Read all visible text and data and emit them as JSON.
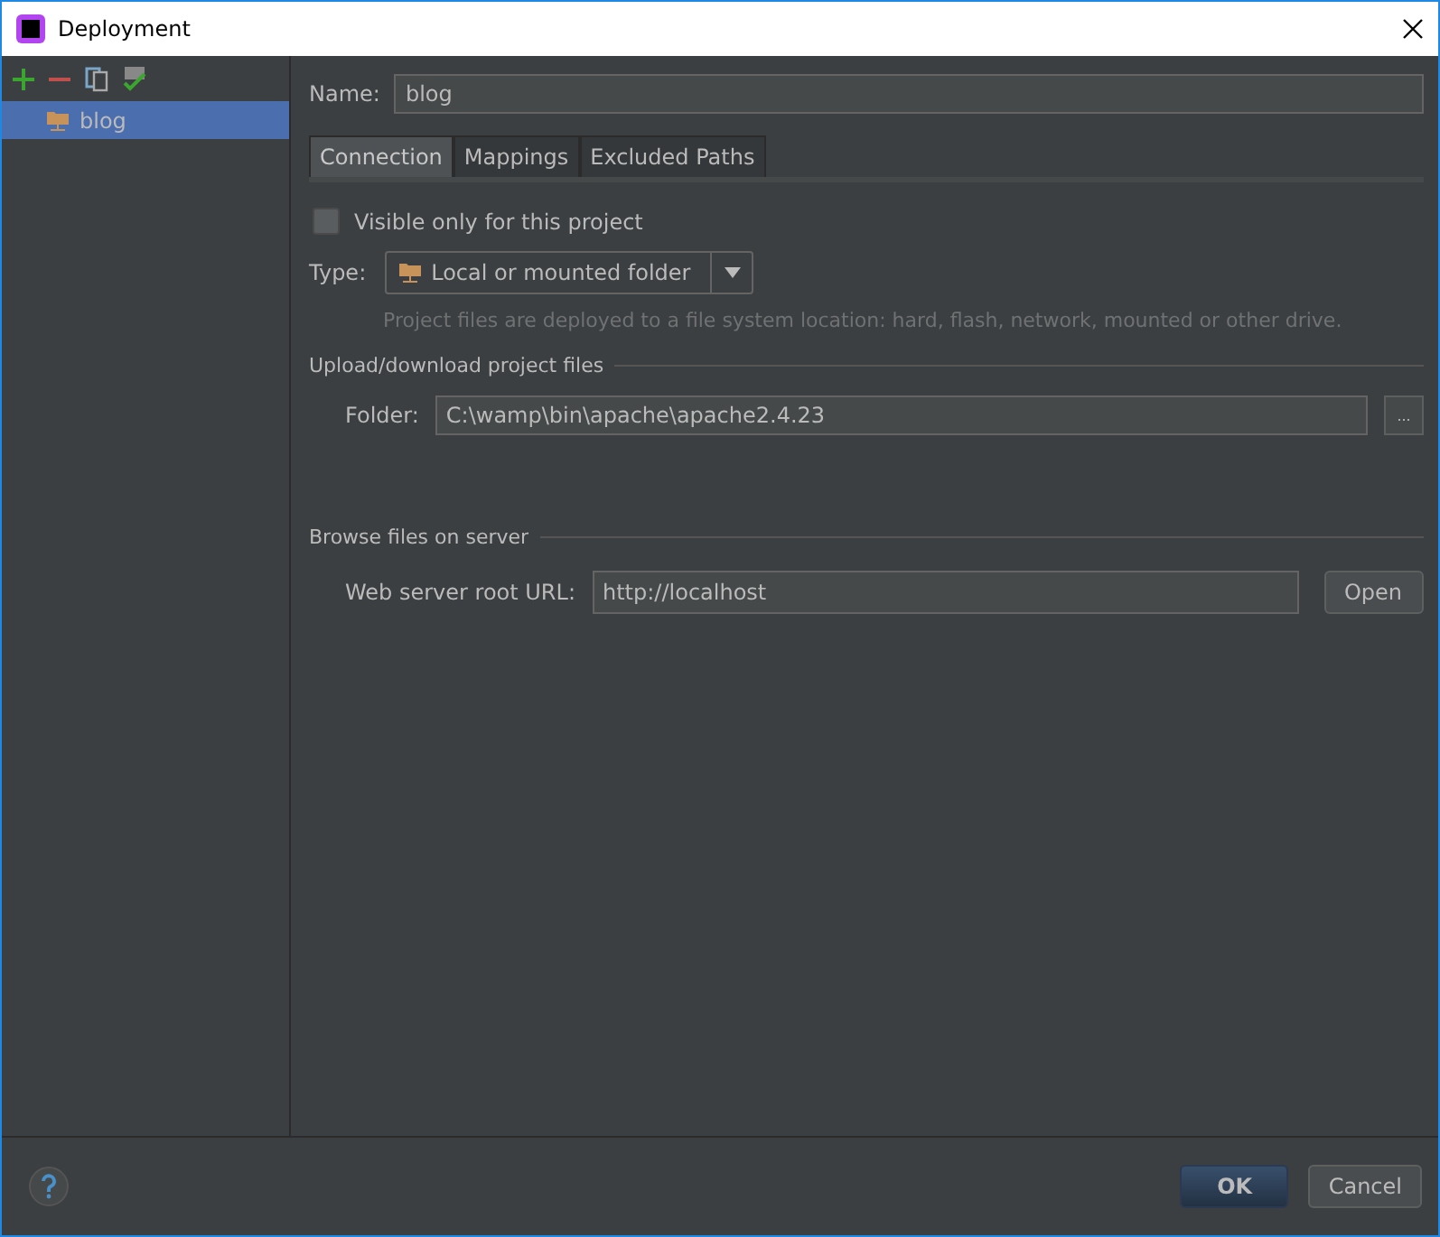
{
  "window": {
    "title": "Deployment"
  },
  "servers": [
    {
      "label": "blog",
      "selected": true
    }
  ],
  "name": {
    "label": "Name:",
    "value": "blog"
  },
  "tabs": [
    {
      "label": "Connection",
      "selected": true
    },
    {
      "label": "Mappings",
      "selected": false
    },
    {
      "label": "Excluded Paths",
      "selected": false
    }
  ],
  "visible_only": {
    "label": "Visible only for this project",
    "checked": false
  },
  "type": {
    "label": "Type:",
    "value": "Local or mounted folder",
    "hint": "Project files are deployed to a file system location: hard, flash, network, mounted or other drive."
  },
  "upload_section": {
    "title": "Upload/download project files",
    "folder_label": "Folder:",
    "folder_value": "C:\\wamp\\bin\\apache\\apache2.4.23",
    "browse": "..."
  },
  "browse_section": {
    "title": "Browse files on server",
    "url_label": "Web server root URL:",
    "url_value": "http://localhost",
    "open": "Open"
  },
  "buttons": [
    {
      "label": "OK",
      "default": true
    },
    {
      "label": "Cancel",
      "default": false
    }
  ]
}
